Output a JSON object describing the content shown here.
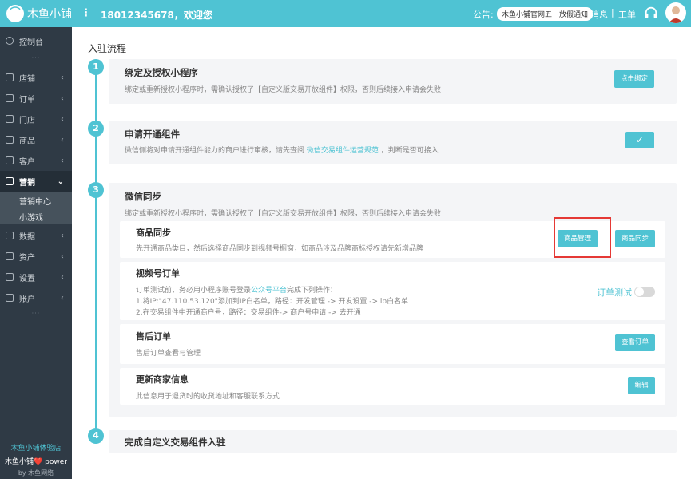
{
  "topbar": {
    "logo_text": "木鱼小铺",
    "welcome": "18012345678，欢迎您",
    "notice_label": "公告:",
    "notice_text": "木鱼小铺官网五一放假通知",
    "messages": "消息",
    "separator": "|",
    "tickets": "工单"
  },
  "sidebar": {
    "items": [
      {
        "label": "控制台",
        "icon": "dashboard-icon"
      },
      {
        "label": "店铺",
        "icon": "shop-icon"
      },
      {
        "label": "订单",
        "icon": "order-icon"
      },
      {
        "label": "门店",
        "icon": "store-icon"
      },
      {
        "label": "商品",
        "icon": "goods-icon"
      },
      {
        "label": "客户",
        "icon": "customer-icon"
      },
      {
        "label": "营销",
        "icon": "marketing-icon"
      },
      {
        "label": "数据",
        "icon": "data-icon"
      },
      {
        "label": "资产",
        "icon": "asset-icon"
      },
      {
        "label": "设置",
        "icon": "settings-icon"
      },
      {
        "label": "账户",
        "icon": "account-icon"
      }
    ],
    "subitems": [
      "营销中心",
      "小游戏"
    ],
    "footer": {
      "store": "木鱼小铺体验店",
      "power": "木鱼小铺❤️ power",
      "by": "by 木鱼网络"
    }
  },
  "main": {
    "title": "入驻流程",
    "steps": [
      {
        "num": "1",
        "title": "绑定及授权小程序",
        "desc": "绑定或重新授权小程序时，需确认授权了【自定义版交易开放组件】权限，否则后续接入申请会失败",
        "button": "点击绑定"
      },
      {
        "num": "2",
        "title": "申请开通组件",
        "desc_pre": "微信侧将对申请开通组件能力的商户进行审核，请先查阅 ",
        "desc_link": "微信交易组件运营规范",
        "desc_post": " ，判断是否可接入",
        "button": "✓"
      },
      {
        "num": "3",
        "title": "微信同步",
        "desc": "绑定或重新授权小程序时，需确认授权了【自定义版交易开放组件】权限，否则后续接入申请会失败",
        "sub": {
          "goods_sync": {
            "title": "商品同步",
            "desc": "先开通商品类目，然后选择商品同步到视频号橱窗，如商品涉及品牌商标授权请先新增品牌",
            "btn_manage": "商品管理",
            "btn_sync": "商品同步"
          },
          "video_order": {
            "title": "视频号订单",
            "line1_pre": "订单测试前，务必用小程序账号登录",
            "line1_link": "公众号平台",
            "line1_post": "完成下列操作：",
            "line2": "1.将IP:\"47.110.53.120\"添加到IP白名单，路径：开发管理 -> 开发设置 -> ip白名单",
            "line3": "2.在交易组件中开通商户号，路径：交易组件-> 商户号申请 -> 去开通",
            "toggle_label": "订单测试",
            "toggle_on": false
          },
          "after_sale": {
            "title": "售后订单",
            "desc": "售后订单查看与管理",
            "button": "查看订单"
          },
          "merchant_info": {
            "title": "更新商家信息",
            "desc": "此信息用于退货时的收货地址和客服联系方式",
            "button": "编辑"
          }
        }
      },
      {
        "num": "4",
        "title": "完成自定义交易组件入驻"
      }
    ]
  }
}
